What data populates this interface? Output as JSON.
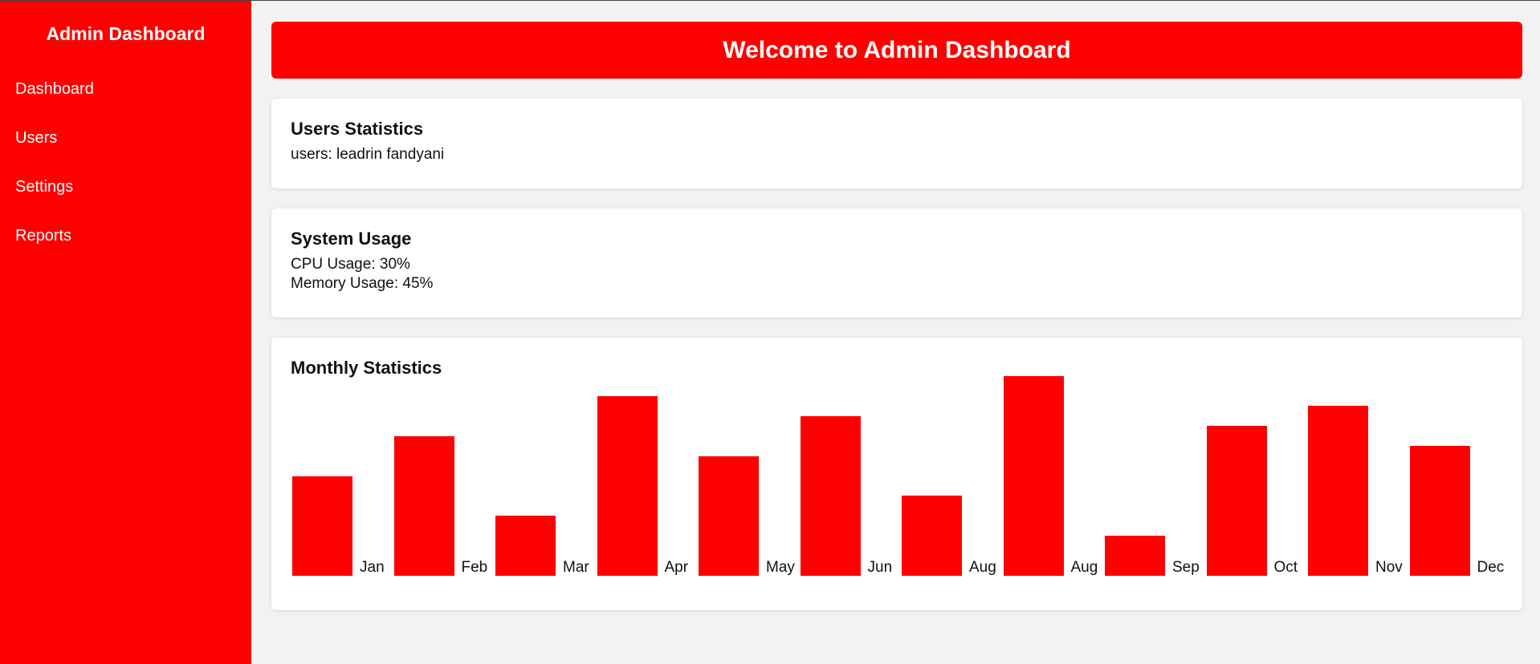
{
  "sidebar": {
    "title": "Admin Dashboard",
    "items": [
      {
        "label": "Dashboard"
      },
      {
        "label": "Users"
      },
      {
        "label": "Settings"
      },
      {
        "label": "Reports"
      }
    ]
  },
  "header": {
    "title": "Welcome to Admin Dashboard"
  },
  "users_card": {
    "title": "Users Statistics",
    "text": "users: leadrin fandyani"
  },
  "system_card": {
    "title": "System Usage",
    "cpu": "CPU Usage: 30%",
    "memory": "Memory Usage: 45%"
  },
  "monthly_card": {
    "title": "Monthly Statistics"
  },
  "colors": {
    "accent": "#ff0000",
    "background": "#f2f2f2",
    "card": "#ffffff"
  },
  "chart_data": {
    "type": "bar",
    "categories": [
      "Jan",
      "Feb",
      "Mar",
      "Apr",
      "May",
      "Jun",
      "Aug",
      "Aug",
      "Sep",
      "Oct",
      "Nov",
      "Dec"
    ],
    "values": [
      50,
      70,
      30,
      90,
      60,
      80,
      40,
      100,
      20,
      75,
      85,
      65
    ],
    "title": "Monthly Statistics",
    "xlabel": "",
    "ylabel": "",
    "ylim": [
      0,
      100
    ],
    "grid": false,
    "legend": "none"
  }
}
